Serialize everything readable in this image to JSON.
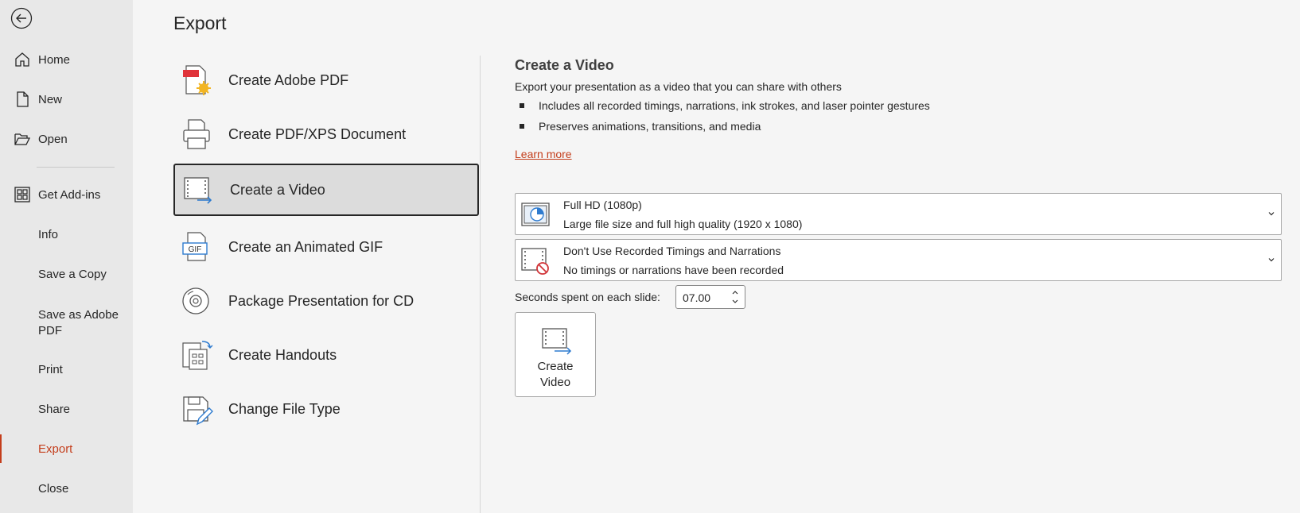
{
  "sidebar": {
    "back_icon": "back-arrow-icon",
    "items": [
      {
        "label": "Home",
        "icon": "home-icon"
      },
      {
        "label": "New",
        "icon": "new-document-icon"
      },
      {
        "label": "Open",
        "icon": "folder-open-icon"
      },
      {
        "label": "Get Add-ins",
        "icon": "add-ins-grid-icon"
      },
      {
        "label": "Info"
      },
      {
        "label": "Save a Copy"
      },
      {
        "label": "Save as Adobe PDF"
      },
      {
        "label": "Print"
      },
      {
        "label": "Share"
      },
      {
        "label": "Export",
        "active": true
      },
      {
        "label": "Close"
      }
    ],
    "accent_color": "#c43e1c"
  },
  "main": {
    "title": "Export",
    "options": [
      {
        "label": "Create Adobe PDF",
        "icon": "adobe-pdf-icon"
      },
      {
        "label": "Create PDF/XPS Document",
        "icon": "pdf-xps-printer-icon"
      },
      {
        "label": "Create a Video",
        "icon": "video-filmstrip-icon",
        "selected": true
      },
      {
        "label": "Create an Animated GIF",
        "icon": "gif-icon"
      },
      {
        "label": "Package Presentation for CD",
        "icon": "cd-disc-icon"
      },
      {
        "label": "Create Handouts",
        "icon": "handouts-icon"
      },
      {
        "label": "Change File Type",
        "icon": "change-file-type-icon"
      }
    ]
  },
  "detail": {
    "title": "Create a Video",
    "description": "Export your presentation as a video that you can share with others",
    "bullets": [
      "Includes all recorded timings, narrations, ink strokes, and laser pointer gestures",
      "Preserves animations, transitions, and media"
    ],
    "learn_more": "Learn more",
    "quality": {
      "title": "Full HD (1080p)",
      "subtitle": "Large file size and full high quality (1920 x 1080)",
      "icon": "presentation-quality-icon"
    },
    "timings": {
      "title": "Don't Use Recorded Timings and Narrations",
      "subtitle": "No timings or narrations have been recorded",
      "icon": "no-timings-icon"
    },
    "seconds_label": "Seconds spent on each slide:",
    "seconds_value": "07.00",
    "create_button": {
      "line1": "Create",
      "line2": "Video",
      "icon": "video-filmstrip-icon"
    }
  }
}
